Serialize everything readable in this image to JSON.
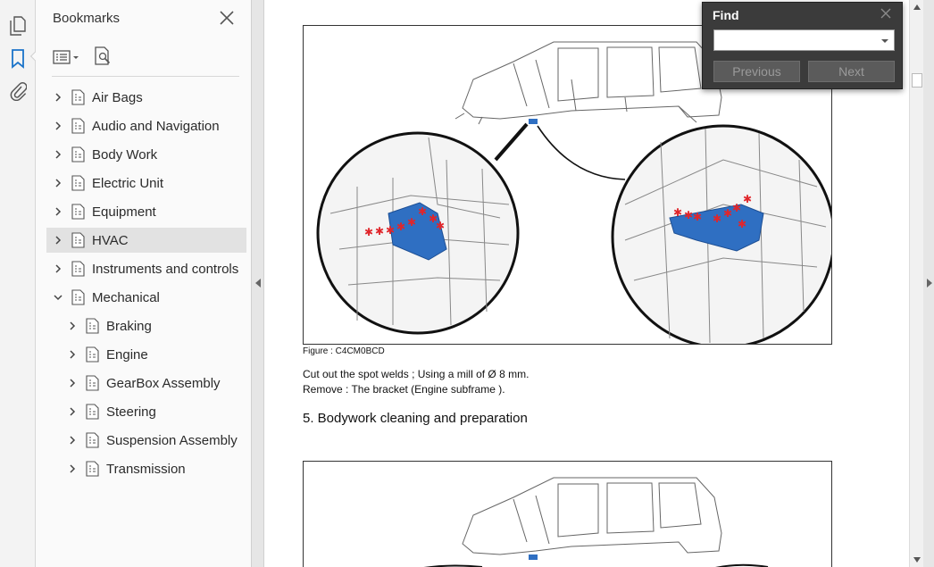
{
  "panel": {
    "title": "Bookmarks"
  },
  "bookmarks": [
    {
      "label": "Air Bags",
      "level": 0,
      "expanded": false,
      "selected": false
    },
    {
      "label": "Audio and Navigation",
      "level": 0,
      "expanded": false,
      "selected": false
    },
    {
      "label": "Body Work",
      "level": 0,
      "expanded": false,
      "selected": false
    },
    {
      "label": "Electric Unit",
      "level": 0,
      "expanded": false,
      "selected": false
    },
    {
      "label": "Equipment",
      "level": 0,
      "expanded": false,
      "selected": false
    },
    {
      "label": "HVAC",
      "level": 0,
      "expanded": false,
      "selected": true
    },
    {
      "label": "Instruments and controls",
      "level": 0,
      "expanded": false,
      "selected": false
    },
    {
      "label": "Mechanical",
      "level": 0,
      "expanded": true,
      "selected": false
    },
    {
      "label": "Braking",
      "level": 1,
      "expanded": false,
      "selected": false
    },
    {
      "label": "Engine",
      "level": 1,
      "expanded": false,
      "selected": false
    },
    {
      "label": "GearBox Assembly",
      "level": 1,
      "expanded": false,
      "selected": false
    },
    {
      "label": "Steering",
      "level": 1,
      "expanded": false,
      "selected": false
    },
    {
      "label": "Suspension Assembly",
      "level": 1,
      "expanded": false,
      "selected": false
    },
    {
      "label": "Transmission",
      "level": 1,
      "expanded": false,
      "selected": false
    }
  ],
  "document": {
    "figure_caption": "Figure : C4CM0BCD",
    "step_1": "Cut out the spot welds ; Using a mill of Ø 8 mm.",
    "step_2": "Remove : The bracket (Engine subframe ).",
    "section_heading": "5. Bodywork cleaning and preparation"
  },
  "find": {
    "title": "Find",
    "value": "",
    "previous_label": "Previous",
    "next_label": "Next"
  },
  "icons": {
    "rail": [
      "pages-icon",
      "bookmark-icon",
      "attachment-icon"
    ],
    "panel_toolbar": [
      "options-menu-icon",
      "bookmark-search-icon"
    ],
    "accent_bookmark": "#1a73c9",
    "part_highlight": "#2f6fc2",
    "weld_mark": "#e0262b"
  }
}
